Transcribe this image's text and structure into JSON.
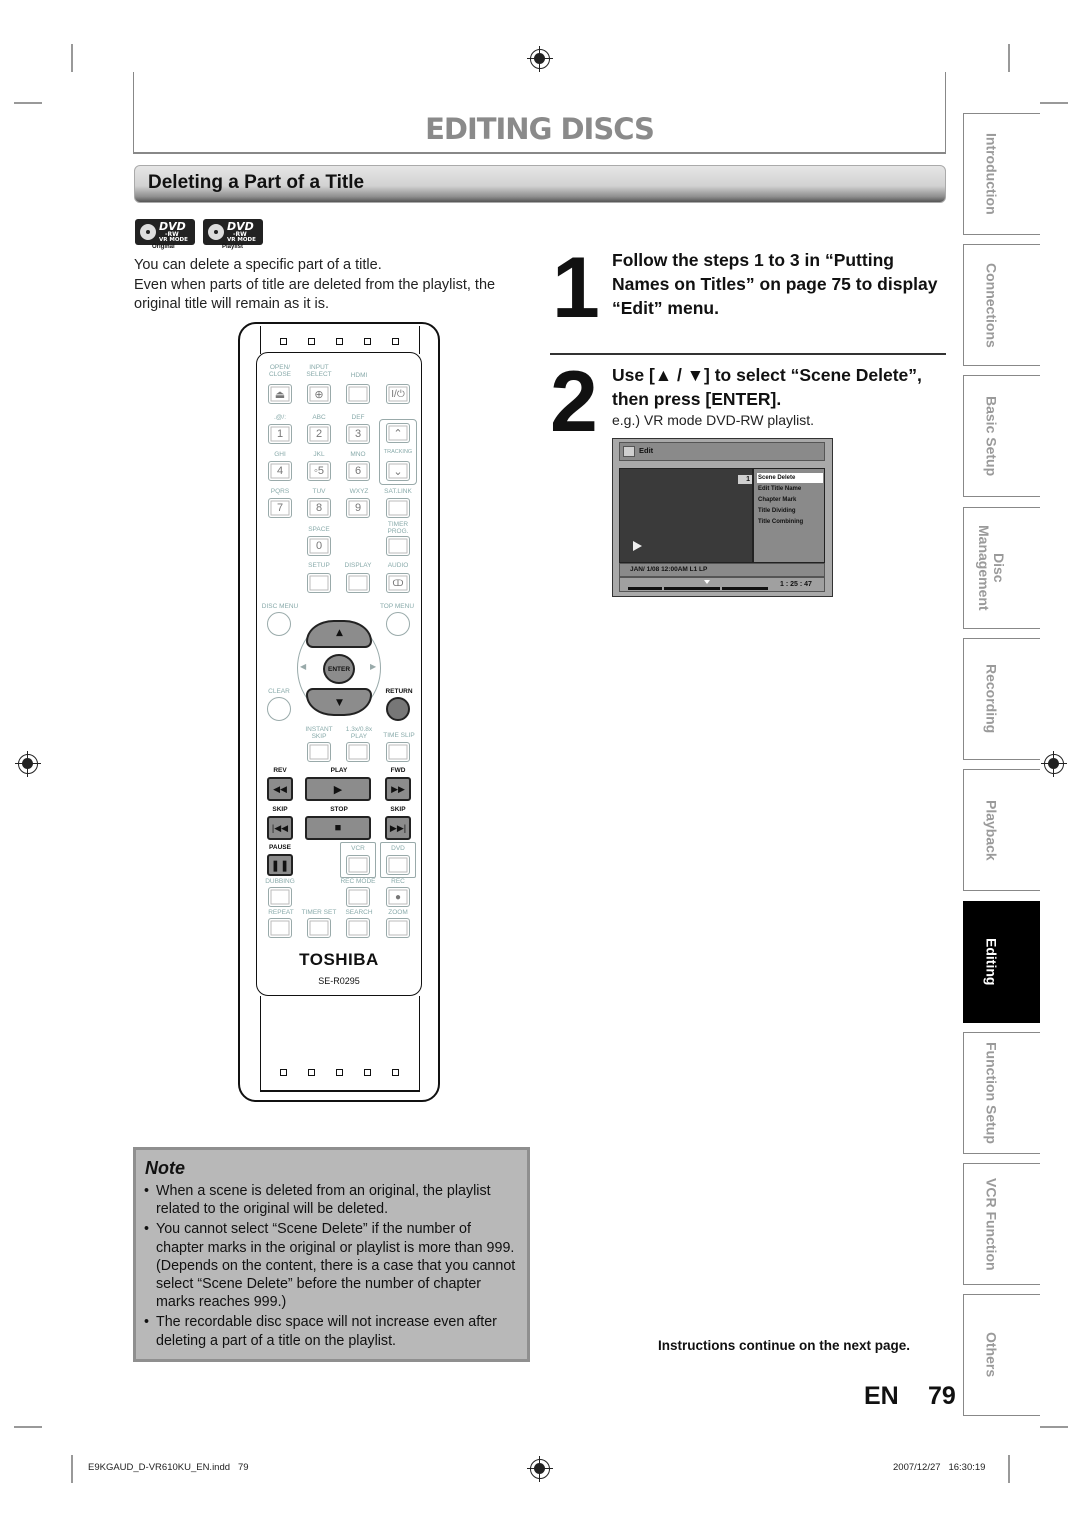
{
  "header": {
    "page_title": "EDITING DISCS",
    "section_title": "Deleting a Part of a Title"
  },
  "badges": [
    {
      "brand": "DVD",
      "format": "-RW",
      "mode": "VR MODE",
      "caption": "Original",
      "icon": "dvd-disc-icon"
    },
    {
      "brand": "DVD",
      "format": "-RW",
      "mode": "VR MODE",
      "caption": "Playlist",
      "icon": "dvd-disc-icon"
    }
  ],
  "intro": {
    "line1": "You can delete a specific part of a title.",
    "line2": "Even when parts of title are deleted from the playlist, the original title will remain as it is."
  },
  "steps": [
    {
      "number": "1",
      "text": "Follow the steps 1 to 3 in “Putting Names on Titles” on page 75 to display “Edit” menu."
    },
    {
      "number": "2",
      "text": "Use [▲ / ▼] to select “Scene Delete”, then press [ENTER].",
      "sub": "e.g.) VR mode DVD-RW playlist."
    }
  ],
  "osd": {
    "header_label": "Edit",
    "title_number": "1",
    "menu_items": [
      "Scene Delete",
      "Edit Title Name",
      "Chapter Mark",
      "Title Dividing",
      "Title Combining"
    ],
    "selected_index": 0,
    "status": "JAN/ 1/08 12:00AM L1   LP",
    "time": "1 : 25 : 47",
    "play_icon": "play-icon"
  },
  "side_tabs": [
    {
      "label": "Introduction",
      "active": false
    },
    {
      "label": "Connections",
      "active": false
    },
    {
      "label": "Basic Setup",
      "active": false
    },
    {
      "label": "Disc\nManagement",
      "active": false
    },
    {
      "label": "Recording",
      "active": false
    },
    {
      "label": "Playback",
      "active": false
    },
    {
      "label": "Editing",
      "active": true
    },
    {
      "label": "Function Setup",
      "active": false
    },
    {
      "label": "VCR Function",
      "active": false
    },
    {
      "label": "Others",
      "active": false
    }
  ],
  "remote": {
    "labels": {
      "open_close": "OPEN/\nCLOSE",
      "input_select": "INPUT\nSELECT",
      "hdmi": "HDMI",
      "k1": ".@/:",
      "k2": "ABC",
      "k3": "DEF",
      "k4": "GHI",
      "k5": "JKL",
      "k6": "MNO",
      "k7": "PQRS",
      "k8": "TUV",
      "k9": "WXYZ",
      "tracking": "TRACKING",
      "satlink": "SAT.LINK",
      "space": "SPACE",
      "timer_prog": "TIMER\nPROG.",
      "setup": "SETUP",
      "display": "DISPLAY",
      "audio": "AUDIO",
      "disc_menu": "DISC MENU",
      "top_menu": "TOP MENU",
      "enter": "ENTER",
      "clear": "CLEAR",
      "return": "RETURN",
      "instant_skip": "INSTANT\nSKIP",
      "play_speed": "1.3x/0.8x\nPLAY",
      "time_slip": "TIME SLIP",
      "rev": "REV",
      "play": "PLAY",
      "fwd": "FWD",
      "skip_back": "SKIP",
      "stop": "STOP",
      "skip_fwd": "SKIP",
      "pause": "PAUSE",
      "vcr": "VCR",
      "dvd": "DVD",
      "dubbing": "DUBBING",
      "rec_mode": "REC MODE",
      "rec": "REC",
      "repeat": "REPEAT",
      "timer_set": "TIMER SET",
      "search": "SEARCH",
      "zoom": "ZOOM"
    },
    "keys": {
      "k1": "1",
      "k2": "2",
      "k3": "3",
      "k4": "4",
      "k5": "◦5",
      "k6": "6",
      "k7": "7",
      "k8": "8",
      "k9": "9",
      "k0": "0",
      "power": "I/⏻"
    },
    "brand": "TOSHIBA",
    "model": "SE-R0295"
  },
  "note": {
    "title": "Note",
    "items": [
      "When a scene is deleted from an original, the playlist related to the original will be deleted.",
      "You cannot select “Scene Delete” if the number of chapter marks in the original or playlist is more than 999. (Depends on the content, there is a case that you cannot select “Scene Delete” before the number of chapter marks reaches 999.)",
      "The recordable disc space will not increase even after deleting a part of a title on the playlist."
    ]
  },
  "footer": {
    "continue_text": "Instructions continue on the next page.",
    "lang": "EN",
    "page_number": "79",
    "file_name": "E9KGAUD_D-VR610KU_EN.indd   79",
    "timestamp": "2007/12/27   16:30:19"
  }
}
